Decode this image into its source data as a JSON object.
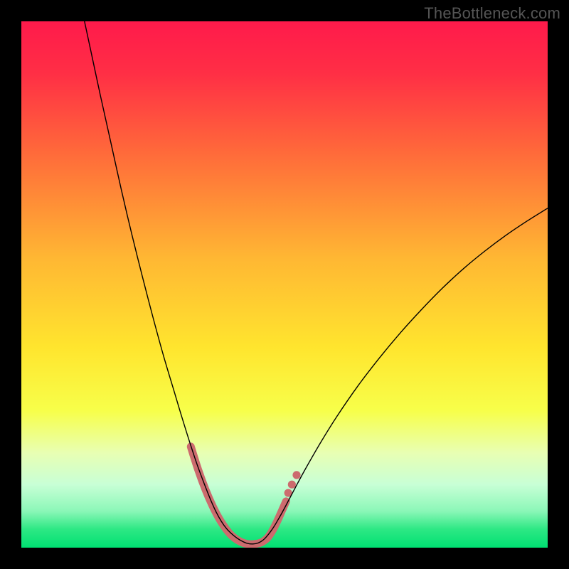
{
  "watermark": "TheBottleneck.com",
  "chart_data": {
    "type": "line",
    "title": "",
    "xlabel": "",
    "ylabel": "",
    "xlim": [
      0,
      100
    ],
    "ylim": [
      0,
      100
    ],
    "gradient_stops": [
      {
        "offset": 0,
        "color": "#ff1a4b"
      },
      {
        "offset": 0.1,
        "color": "#ff2f45"
      },
      {
        "offset": 0.25,
        "color": "#ff6a3a"
      },
      {
        "offset": 0.45,
        "color": "#ffb733"
      },
      {
        "offset": 0.62,
        "color": "#ffe52e"
      },
      {
        "offset": 0.74,
        "color": "#f7ff4a"
      },
      {
        "offset": 0.82,
        "color": "#e8ffb3"
      },
      {
        "offset": 0.88,
        "color": "#c8ffd6"
      },
      {
        "offset": 0.93,
        "color": "#8cf7b8"
      },
      {
        "offset": 0.965,
        "color": "#2de884"
      },
      {
        "offset": 1.0,
        "color": "#00e072"
      }
    ],
    "series": [
      {
        "name": "bottleneck-curve",
        "stroke": "#000000",
        "stroke_width": 1.4,
        "points": [
          {
            "x": 12.0,
            "y": 100.0
          },
          {
            "x": 13.5,
            "y": 93.0
          },
          {
            "x": 15.0,
            "y": 86.0
          },
          {
            "x": 17.0,
            "y": 77.0
          },
          {
            "x": 19.0,
            "y": 68.0
          },
          {
            "x": 21.0,
            "y": 59.5
          },
          {
            "x": 23.0,
            "y": 51.5
          },
          {
            "x": 25.0,
            "y": 43.8
          },
          {
            "x": 27.0,
            "y": 36.5
          },
          {
            "x": 29.0,
            "y": 29.8
          },
          {
            "x": 30.5,
            "y": 24.8
          },
          {
            "x": 32.0,
            "y": 20.0
          },
          {
            "x": 33.5,
            "y": 15.5
          },
          {
            "x": 35.0,
            "y": 11.5
          },
          {
            "x": 36.0,
            "y": 9.0
          },
          {
            "x": 37.0,
            "y": 6.8
          },
          {
            "x": 38.0,
            "y": 5.0
          },
          {
            "x": 39.0,
            "y": 3.6
          },
          {
            "x": 40.0,
            "y": 2.6
          },
          {
            "x": 41.0,
            "y": 1.8
          },
          {
            "x": 42.0,
            "y": 1.2
          },
          {
            "x": 43.0,
            "y": 0.8
          },
          {
            "x": 44.0,
            "y": 0.7
          },
          {
            "x": 45.0,
            "y": 0.9
          },
          {
            "x": 46.0,
            "y": 1.5
          },
          {
            "x": 47.0,
            "y": 2.6
          },
          {
            "x": 48.0,
            "y": 4.0
          },
          {
            "x": 49.0,
            "y": 5.7
          },
          {
            "x": 50.0,
            "y": 7.5
          },
          {
            "x": 52.0,
            "y": 11.3
          },
          {
            "x": 54.0,
            "y": 15.0
          },
          {
            "x": 57.0,
            "y": 20.2
          },
          {
            "x": 60.0,
            "y": 25.0
          },
          {
            "x": 64.0,
            "y": 30.8
          },
          {
            "x": 68.0,
            "y": 36.0
          },
          {
            "x": 72.0,
            "y": 40.8
          },
          {
            "x": 76.0,
            "y": 45.2
          },
          {
            "x": 80.0,
            "y": 49.3
          },
          {
            "x": 84.0,
            "y": 53.0
          },
          {
            "x": 88.0,
            "y": 56.3
          },
          {
            "x": 92.0,
            "y": 59.3
          },
          {
            "x": 96.0,
            "y": 62.0
          },
          {
            "x": 100.0,
            "y": 64.5
          }
        ]
      }
    ],
    "markers": {
      "stroke": "#cc6b6e",
      "stroke_width": 11,
      "cap": "round",
      "segments": [
        [
          {
            "x": 32.2,
            "y": 19.2
          },
          {
            "x": 33.6,
            "y": 14.8
          },
          {
            "x": 35.0,
            "y": 11.0
          },
          {
            "x": 36.3,
            "y": 8.0
          },
          {
            "x": 37.6,
            "y": 5.5
          },
          {
            "x": 39.0,
            "y": 3.4
          },
          {
            "x": 40.3,
            "y": 2.0
          },
          {
            "x": 41.7,
            "y": 1.1
          },
          {
            "x": 43.0,
            "y": 0.7
          },
          {
            "x": 44.3,
            "y": 0.7
          },
          {
            "x": 45.6,
            "y": 1.0
          },
          {
            "x": 46.8,
            "y": 1.9
          },
          {
            "x": 47.8,
            "y": 3.4
          },
          {
            "x": 48.7,
            "y": 5.2
          },
          {
            "x": 49.5,
            "y": 7.0
          },
          {
            "x": 50.3,
            "y": 8.8
          }
        ]
      ],
      "dots": [
        {
          "x": 50.7,
          "y": 10.4
        },
        {
          "x": 51.4,
          "y": 12.0
        },
        {
          "x": 52.3,
          "y": 13.8
        }
      ],
      "dot_radius": 5.6
    }
  }
}
